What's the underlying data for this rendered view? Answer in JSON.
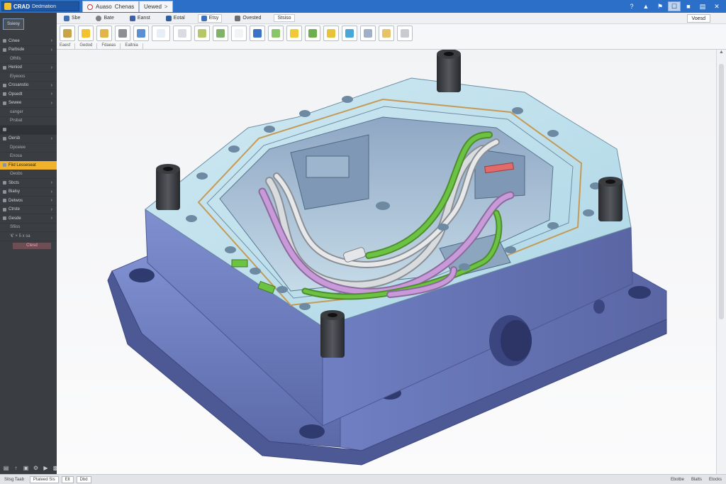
{
  "app": {
    "title": "CRAD",
    "subtitle": "Dedmation"
  },
  "tabs": [
    {
      "label": "Auaso",
      "extra": "Chenas"
    },
    {
      "label": "Uewed"
    }
  ],
  "titlebar_right": [
    "?",
    "▲",
    "⚑",
    "☐",
    "■",
    "▤",
    "✕"
  ],
  "ribbon": {
    "tabs": [
      "Sbe",
      "Bate",
      "Eanst",
      "Eotal",
      "Etsy",
      "Ovested",
      "Stsiso"
    ],
    "right_button": "Voesd",
    "groups": [
      "Eaesf",
      "Gedod",
      "Fdaeas",
      "Ealtnia"
    ]
  },
  "sidebar": {
    "top_button": "Ssiesy",
    "items": [
      {
        "label": "Cinee",
        "sub": false
      },
      {
        "label": "Parbsde",
        "sub": false
      },
      {
        "label": "Ofhfis",
        "sub": true
      },
      {
        "label": "Heniod",
        "sub": false
      },
      {
        "label": "Eiyeoos",
        "sub": true
      },
      {
        "label": "Crssanstio",
        "sub": false
      },
      {
        "label": "Opsedt",
        "sub": false
      },
      {
        "label": "Sewee",
        "sub": false
      },
      {
        "label": "oanger",
        "sub": true
      },
      {
        "label": "Prsbat",
        "sub": true
      },
      {
        "label": "",
        "sub": false
      },
      {
        "label": "Oersb",
        "sub": false
      },
      {
        "label": "Dpceiee",
        "sub": true
      },
      {
        "label": "Enosa",
        "sub": true
      },
      {
        "label": "Fiid Lesseseat",
        "sub": false,
        "highlight": true
      },
      {
        "label": "Oeobs",
        "sub": true
      },
      {
        "label": "Sbcts",
        "sub": false
      },
      {
        "label": "Bialsy",
        "sub": false
      },
      {
        "label": "Detwos",
        "sub": false
      },
      {
        "label": "Ctrste",
        "sub": false
      },
      {
        "label": "Gesde",
        "sub": false
      },
      {
        "label": "Sfiiss",
        "sub": true
      },
      {
        "label": "‘€’ × 5 x sa",
        "sub": true
      }
    ],
    "red_tag": "Ctesd",
    "bottom_icons": [
      "▤",
      "↑",
      "▣",
      "⚙",
      "▶",
      "▩"
    ]
  },
  "status": {
    "left": "Sitsg Taab",
    "box1": "Ptateed Sis",
    "box2": "Elt",
    "box3": "Dbd",
    "right": [
      "Ebotbe",
      "Blatts",
      "Etocks"
    ]
  },
  "colors": {
    "accent": "#2b6fc9",
    "sidebar": "#3a3d42",
    "highlight": "#f0b22a",
    "part_top": "#bfe0ec",
    "part_side": "#6f7fbf",
    "tube_green": "#6cc243",
    "tube_purple": "#c89ad9",
    "tube_grey": "#d9dcdf"
  }
}
